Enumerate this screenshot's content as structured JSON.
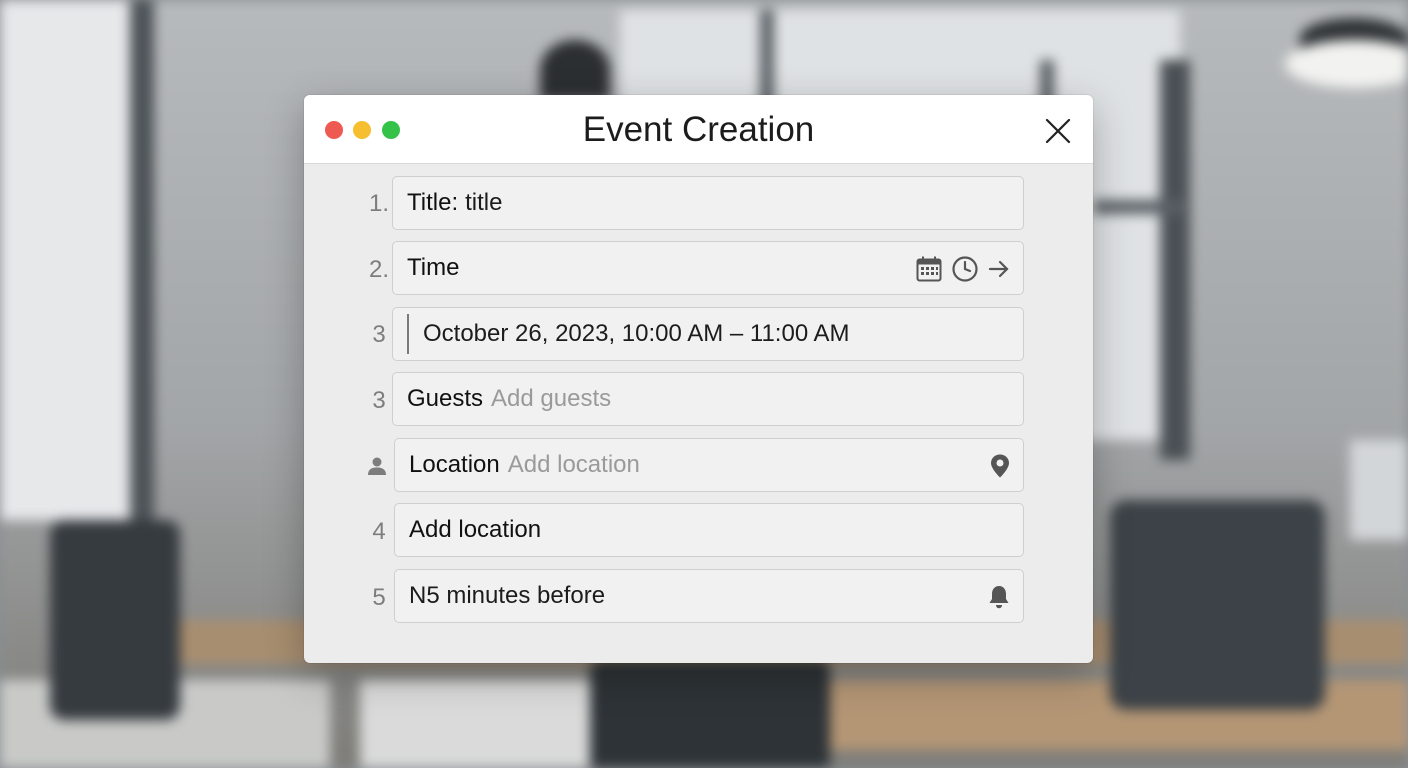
{
  "window": {
    "title": "Event Creation"
  },
  "rows": [
    {
      "number": "1.",
      "label": "Title:",
      "value": "title"
    },
    {
      "number": "2.",
      "label": "Time",
      "icons": [
        "calendar-icon",
        "clock-icon",
        "arrow-right-icon"
      ]
    },
    {
      "number": "3",
      "value": "October 26, 2023, 10:00 AM – 11:00 AM"
    },
    {
      "number": "3",
      "label": "Guests",
      "placeholder": "Add guests"
    },
    {
      "icon": "person-icon",
      "label": "Location",
      "placeholder": "Add location",
      "trailing_icon": "map-pin-icon"
    },
    {
      "number": "4",
      "label": "Add location"
    },
    {
      "number": "5",
      "value": "N5 minutes before",
      "trailing_icon": "bell-icon"
    }
  ],
  "colors": {
    "close_red": "#ee5a52",
    "minimize_yellow": "#f5bf2f",
    "zoom_green": "#35c249",
    "dialog_bg": "#ececec",
    "field_bg": "#f1f1f1",
    "placeholder_gray": "#9a9a9a"
  }
}
